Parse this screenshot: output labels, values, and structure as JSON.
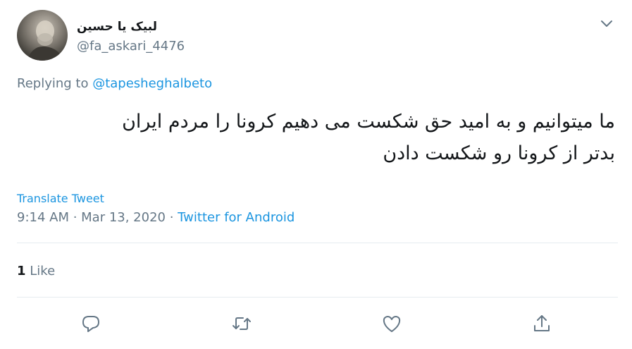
{
  "tweet": {
    "author": {
      "display_name": "لبیک یا حسین",
      "handle": "@fa_askari_4476"
    },
    "replying_to": {
      "prefix": "Replying to",
      "mention": "@tapesheghalbeto"
    },
    "text_lines": [
      "ما میتوانیم و به امید حق شکست می دهیم کرونا را مردم ایران",
      "بدتر از کرونا رو شکست دادن"
    ],
    "translate_label": "Translate Tweet",
    "timestamp": "9:14 AM · Mar 13, 2020 · ",
    "source": "Twitter for Android",
    "likes": {
      "count": "1",
      "label": "Like"
    }
  },
  "colors": {
    "link": "#1b95e0",
    "muted": "#657786",
    "text": "#14171a",
    "divider": "#e6ecf0"
  },
  "icons": [
    "chevron-down-icon",
    "reply-icon",
    "retweet-icon",
    "like-icon",
    "share-icon"
  ]
}
